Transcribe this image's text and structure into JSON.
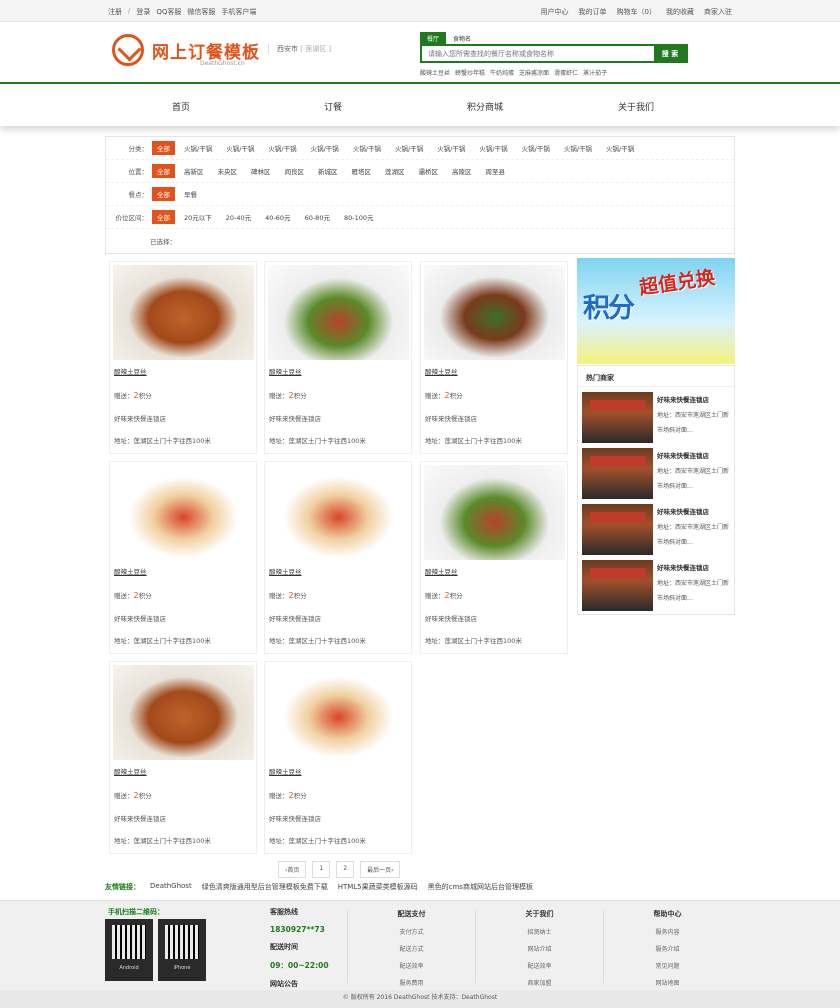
{
  "topbar": {
    "left": [
      "注册",
      "/",
      "登录",
      "QQ客服",
      "微信客服",
      "手机客户端"
    ],
    "right": [
      "用户中心",
      "我的订单",
      "购物车（0）",
      "我的收藏",
      "商家入驻"
    ]
  },
  "header": {
    "logo_title": "网上订餐模板",
    "logo_sub": "DeathGhost.cn",
    "city": "西安市",
    "area": "[ 莲湖区 ]",
    "search_tabs": [
      "餐厅",
      "食物名"
    ],
    "search_placeholder": "请输入您所需查找的餐厅名称或食物名称",
    "search_button": "搜 索",
    "hot_words": [
      "酸辣土豆丝",
      "螃蟹炒年糕",
      "牛奶炖蛋",
      "芝麻酱凉面",
      "滑蛋虾仁",
      "蒸汁茄子"
    ]
  },
  "nav": [
    "首页",
    "订餐",
    "积分商城",
    "关于我们"
  ],
  "filters": {
    "category": {
      "label": "分类：",
      "options": [
        "全部",
        "火锅/干锅",
        "火锅/干锅",
        "火锅/干锅",
        "火锅/干锅",
        "火锅/干锅",
        "火锅/干锅",
        "火锅/干锅",
        "火锅/干锅",
        "火锅/干锅",
        "火锅/干锅",
        "火锅/干锅"
      ]
    },
    "location": {
      "label": "位置：",
      "options": [
        "全部",
        "高新区",
        "未央区",
        "碑林区",
        "阎良区",
        "新城区",
        "雁塔区",
        "莲湖区",
        "灞桥区",
        "高陵区",
        "周至县"
      ]
    },
    "meal": {
      "label": "餐点：",
      "options": [
        "全部",
        "早餐"
      ]
    },
    "price": {
      "label": "价位区间：",
      "options": [
        "全部",
        "20元以下",
        "20-40元",
        "40-60元",
        "60-80元",
        "80-100元"
      ]
    },
    "selected": {
      "label": "已选择："
    }
  },
  "products": [
    {
      "name": "酸辣土豆丝",
      "pts_prefix": "赠送：",
      "pts": "2",
      "pts_unit": "积分",
      "shop": "好味来快餐连锁店",
      "addr": "地址：莲湖区土门十字往西100米"
    },
    {
      "name": "酸辣土豆丝",
      "pts_prefix": "赠送：",
      "pts": "2",
      "pts_unit": "积分",
      "shop": "好味来快餐连锁店",
      "addr": "地址：莲湖区土门十字往西100米"
    },
    {
      "name": "酸辣土豆丝",
      "pts_prefix": "赠送：",
      "pts": "2",
      "pts_unit": "积分",
      "shop": "好味来快餐连锁店",
      "addr": "地址：莲湖区土门十字往西100米"
    },
    {
      "name": "酸辣土豆丝",
      "pts_prefix": "赠送：",
      "pts": "2",
      "pts_unit": "积分",
      "shop": "好味来快餐连锁店",
      "addr": "地址：莲湖区土门十字往西100米"
    },
    {
      "name": "酸辣土豆丝",
      "pts_prefix": "赠送：",
      "pts": "2",
      "pts_unit": "积分",
      "shop": "好味来快餐连锁店",
      "addr": "地址：莲湖区土门十字往西100米"
    },
    {
      "name": "酸辣土豆丝",
      "pts_prefix": "赠送：",
      "pts": "2",
      "pts_unit": "积分",
      "shop": "好味来快餐连锁店",
      "addr": "地址：莲湖区土门十字往西100米"
    },
    {
      "name": "酸辣土豆丝",
      "pts_prefix": "赠送：",
      "pts": "2",
      "pts_unit": "积分",
      "shop": "好味来快餐连锁店",
      "addr": "地址：莲湖区土门十字往西100米"
    },
    {
      "name": "酸辣土豆丝",
      "pts_prefix": "赠送：",
      "pts": "2",
      "pts_unit": "积分",
      "shop": "好味来快餐连锁店",
      "addr": "地址：莲湖区土门十字往西100米"
    }
  ],
  "side": {
    "banner_a": "积分",
    "banner_b": "超值兑换",
    "hot_title": "热门商家",
    "shops": [
      {
        "name": "好味来快餐连锁店",
        "addr": "地址：西安市莲湖区土门新市场斜对面..."
      },
      {
        "name": "好味来快餐连锁店",
        "addr": "地址：西安市莲湖区土门新市场斜对面..."
      },
      {
        "name": "好味来快餐连锁店",
        "addr": "地址：西安市莲湖区土门新市场斜对面..."
      },
      {
        "name": "好味来快餐连锁店",
        "addr": "地址：西安市莲湖区土门新市场斜对面..."
      }
    ]
  },
  "pager": [
    "‹首页",
    "1",
    "2",
    "最后一页›"
  ],
  "links": {
    "head": "友情链接：",
    "items": [
      "DeathGhost",
      "绿色清爽版通用型后台管理模板免费下载",
      "HTML5果蔬菜类模板源码",
      "黑色的cms商城网站后台管理模板"
    ]
  },
  "footer": {
    "qr_title": "手机扫描二维码：",
    "qr_caps": [
      "Android",
      "iPhone"
    ],
    "hotline_label": "客服热线",
    "hotline": "1830927**73",
    "time_label": "配送时间",
    "time": "09：00~22:00",
    "notice": "网站公告",
    "cols": [
      {
        "title": "配送支付",
        "items": [
          "支付方式",
          "配送方式",
          "配送效率",
          "服务费用"
        ]
      },
      {
        "title": "关于我们",
        "items": [
          "招贤纳士",
          "网站介绍",
          "配送效率",
          "商家加盟"
        ]
      },
      {
        "title": "帮助中心",
        "items": [
          "服务内容",
          "服务介绍",
          "常见问题",
          "网站地图"
        ]
      }
    ],
    "copyright": "© 版权所有 2016 DeathGhost 技术支持：DeathGhost"
  },
  "colors": {
    "accent": "#e2531b",
    "brand_green": "#1f7a1f"
  }
}
